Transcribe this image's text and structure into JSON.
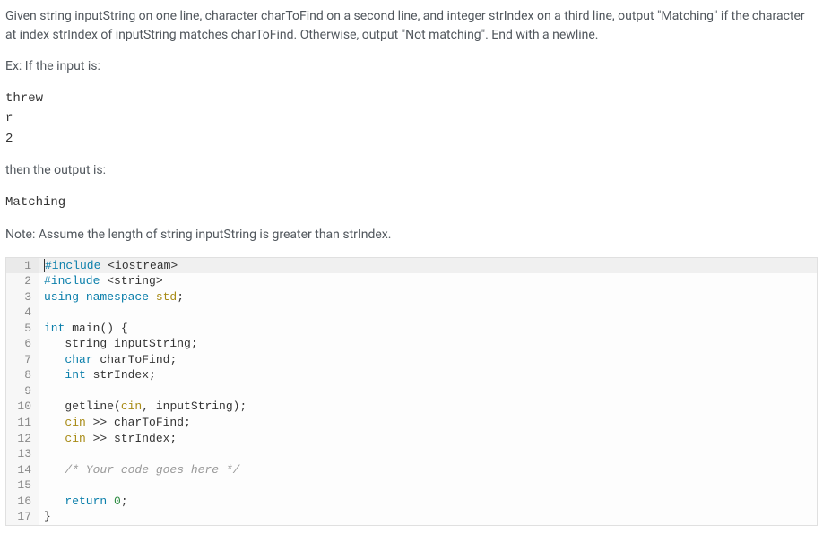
{
  "instruction": "Given string inputString on one line, character charToFind on a second line, and integer strIndex on a third line, output \"Matching\" if the character at index strIndex of inputString matches charToFind. Otherwise, output \"Not matching\". End with a newline.",
  "ex_label": "Ex: If the input is:",
  "input_example": "threw\nr\n2",
  "then_label": "then the output is:",
  "output_example": "Matching",
  "note": "Note: Assume the length of string inputString is greater than strIndex.",
  "code": {
    "lines": [
      {
        "n": 1,
        "hl": true,
        "tokens": [
          {
            "t": "#include ",
            "c": "kw"
          },
          {
            "t": "<iostream>",
            "c": ""
          }
        ]
      },
      {
        "n": 2,
        "tokens": [
          {
            "t": "#include ",
            "c": "kw"
          },
          {
            "t": "<string>",
            "c": ""
          }
        ]
      },
      {
        "n": 3,
        "tokens": [
          {
            "t": "using ",
            "c": "kw"
          },
          {
            "t": "namespace ",
            "c": "kw"
          },
          {
            "t": "std",
            "c": "ns"
          },
          {
            "t": ";",
            "c": ""
          }
        ]
      },
      {
        "n": 4,
        "tokens": []
      },
      {
        "n": 5,
        "tokens": [
          {
            "t": "int ",
            "c": "type"
          },
          {
            "t": "main",
            "c": "fn"
          },
          {
            "t": "() {",
            "c": ""
          }
        ]
      },
      {
        "n": 6,
        "tokens": [
          {
            "t": "   string ",
            "c": ""
          },
          {
            "t": "inputString",
            "c": ""
          },
          {
            "t": ";",
            "c": ""
          }
        ]
      },
      {
        "n": 7,
        "tokens": [
          {
            "t": "   char ",
            "c": "type"
          },
          {
            "t": "charToFind",
            "c": ""
          },
          {
            "t": ";",
            "c": ""
          }
        ]
      },
      {
        "n": 8,
        "tokens": [
          {
            "t": "   int ",
            "c": "type"
          },
          {
            "t": "strIndex",
            "c": ""
          },
          {
            "t": ";",
            "c": ""
          }
        ]
      },
      {
        "n": 9,
        "tokens": []
      },
      {
        "n": 10,
        "tokens": [
          {
            "t": "   getline",
            "c": "fn"
          },
          {
            "t": "(",
            "c": ""
          },
          {
            "t": "cin",
            "c": "ns"
          },
          {
            "t": ", inputString);",
            "c": ""
          }
        ]
      },
      {
        "n": 11,
        "tokens": [
          {
            "t": "   cin ",
            "c": "ns"
          },
          {
            "t": ">> ",
            "c": "op"
          },
          {
            "t": "charToFind;",
            "c": ""
          }
        ]
      },
      {
        "n": 12,
        "tokens": [
          {
            "t": "   cin ",
            "c": "ns"
          },
          {
            "t": ">> ",
            "c": "op"
          },
          {
            "t": "strIndex;",
            "c": ""
          }
        ]
      },
      {
        "n": 13,
        "tokens": []
      },
      {
        "n": 14,
        "tokens": [
          {
            "t": "   /* Your code goes here */",
            "c": "cmt"
          }
        ]
      },
      {
        "n": 15,
        "tokens": []
      },
      {
        "n": 16,
        "tokens": [
          {
            "t": "   return ",
            "c": "kw"
          },
          {
            "t": "0",
            "c": "num"
          },
          {
            "t": ";",
            "c": ""
          }
        ]
      },
      {
        "n": 17,
        "tokens": [
          {
            "t": "}",
            "c": ""
          }
        ]
      }
    ]
  }
}
